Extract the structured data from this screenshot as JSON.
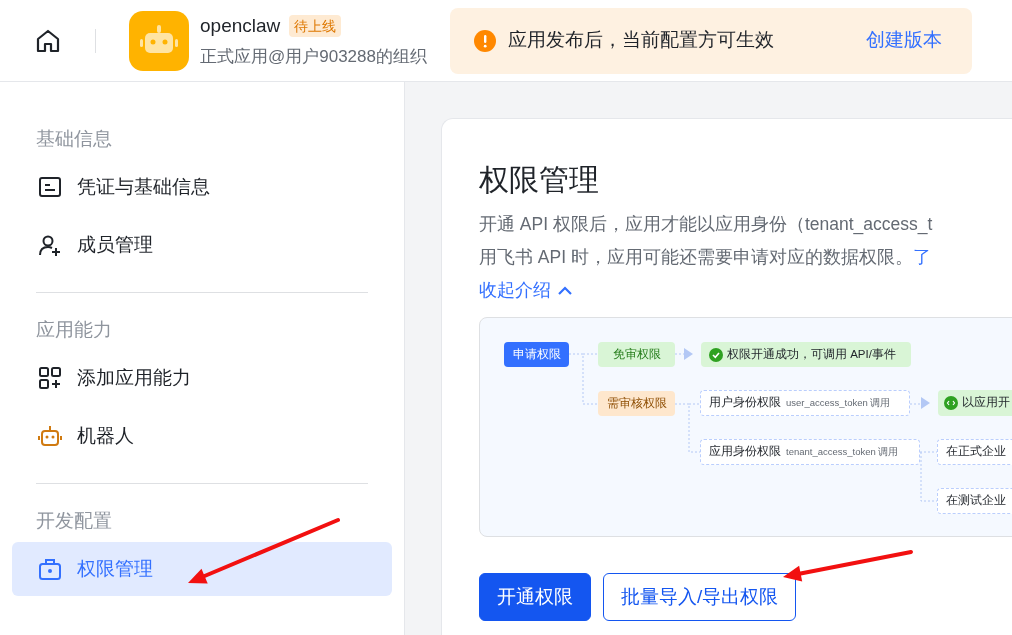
{
  "header": {
    "app": {
      "name": "openclaw",
      "status_badge": "待上线",
      "org": "正式应用@用户903288的组织"
    },
    "notice": {
      "text": "应用发布后，当前配置方可生效",
      "action": "创建版本"
    }
  },
  "sidebar": {
    "sections": [
      {
        "title": "基础信息",
        "items": [
          {
            "label": "凭证与基础信息",
            "selected": false
          },
          {
            "label": "成员管理",
            "selected": false
          }
        ]
      },
      {
        "title": "应用能力",
        "items": [
          {
            "label": "添加应用能力",
            "selected": false
          },
          {
            "label": "机器人",
            "selected": false
          }
        ]
      },
      {
        "title": "开发配置",
        "items": [
          {
            "label": "权限管理",
            "selected": true
          }
        ]
      }
    ]
  },
  "main": {
    "title": "权限管理",
    "description": [
      {
        "text": "开通 API 权限后，应用才能以应用身份（tenant_access_t"
      },
      {
        "text": "用飞书 API 时，应用可能还需要申请对应的数据权限。",
        "link": "了"
      }
    ],
    "collapse_link": "收起介绍",
    "diagram": {
      "nodes": [
        {
          "kind": "primary",
          "label": "申请权限"
        },
        {
          "kind": "free",
          "label": "免审权限"
        },
        {
          "kind": "success",
          "label": "权限开通成功，可调用 API/事件"
        },
        {
          "kind": "review",
          "label": "需审核权限"
        },
        {
          "kind": "identity",
          "label": "用户身份权限",
          "note": "user_access_token 调用"
        },
        {
          "kind": "result",
          "label": "以应用开"
        },
        {
          "kind": "identity",
          "label": "应用身份权限",
          "note": "tenant_access_token 调用"
        },
        {
          "kind": "plain",
          "label": "在正式企业"
        },
        {
          "kind": "plain",
          "label": "在测试企业"
        }
      ]
    },
    "buttons": [
      {
        "label": "开通权限",
        "kind": "primary"
      },
      {
        "label": "批量导入/导出权限",
        "kind": "outline"
      }
    ]
  }
}
